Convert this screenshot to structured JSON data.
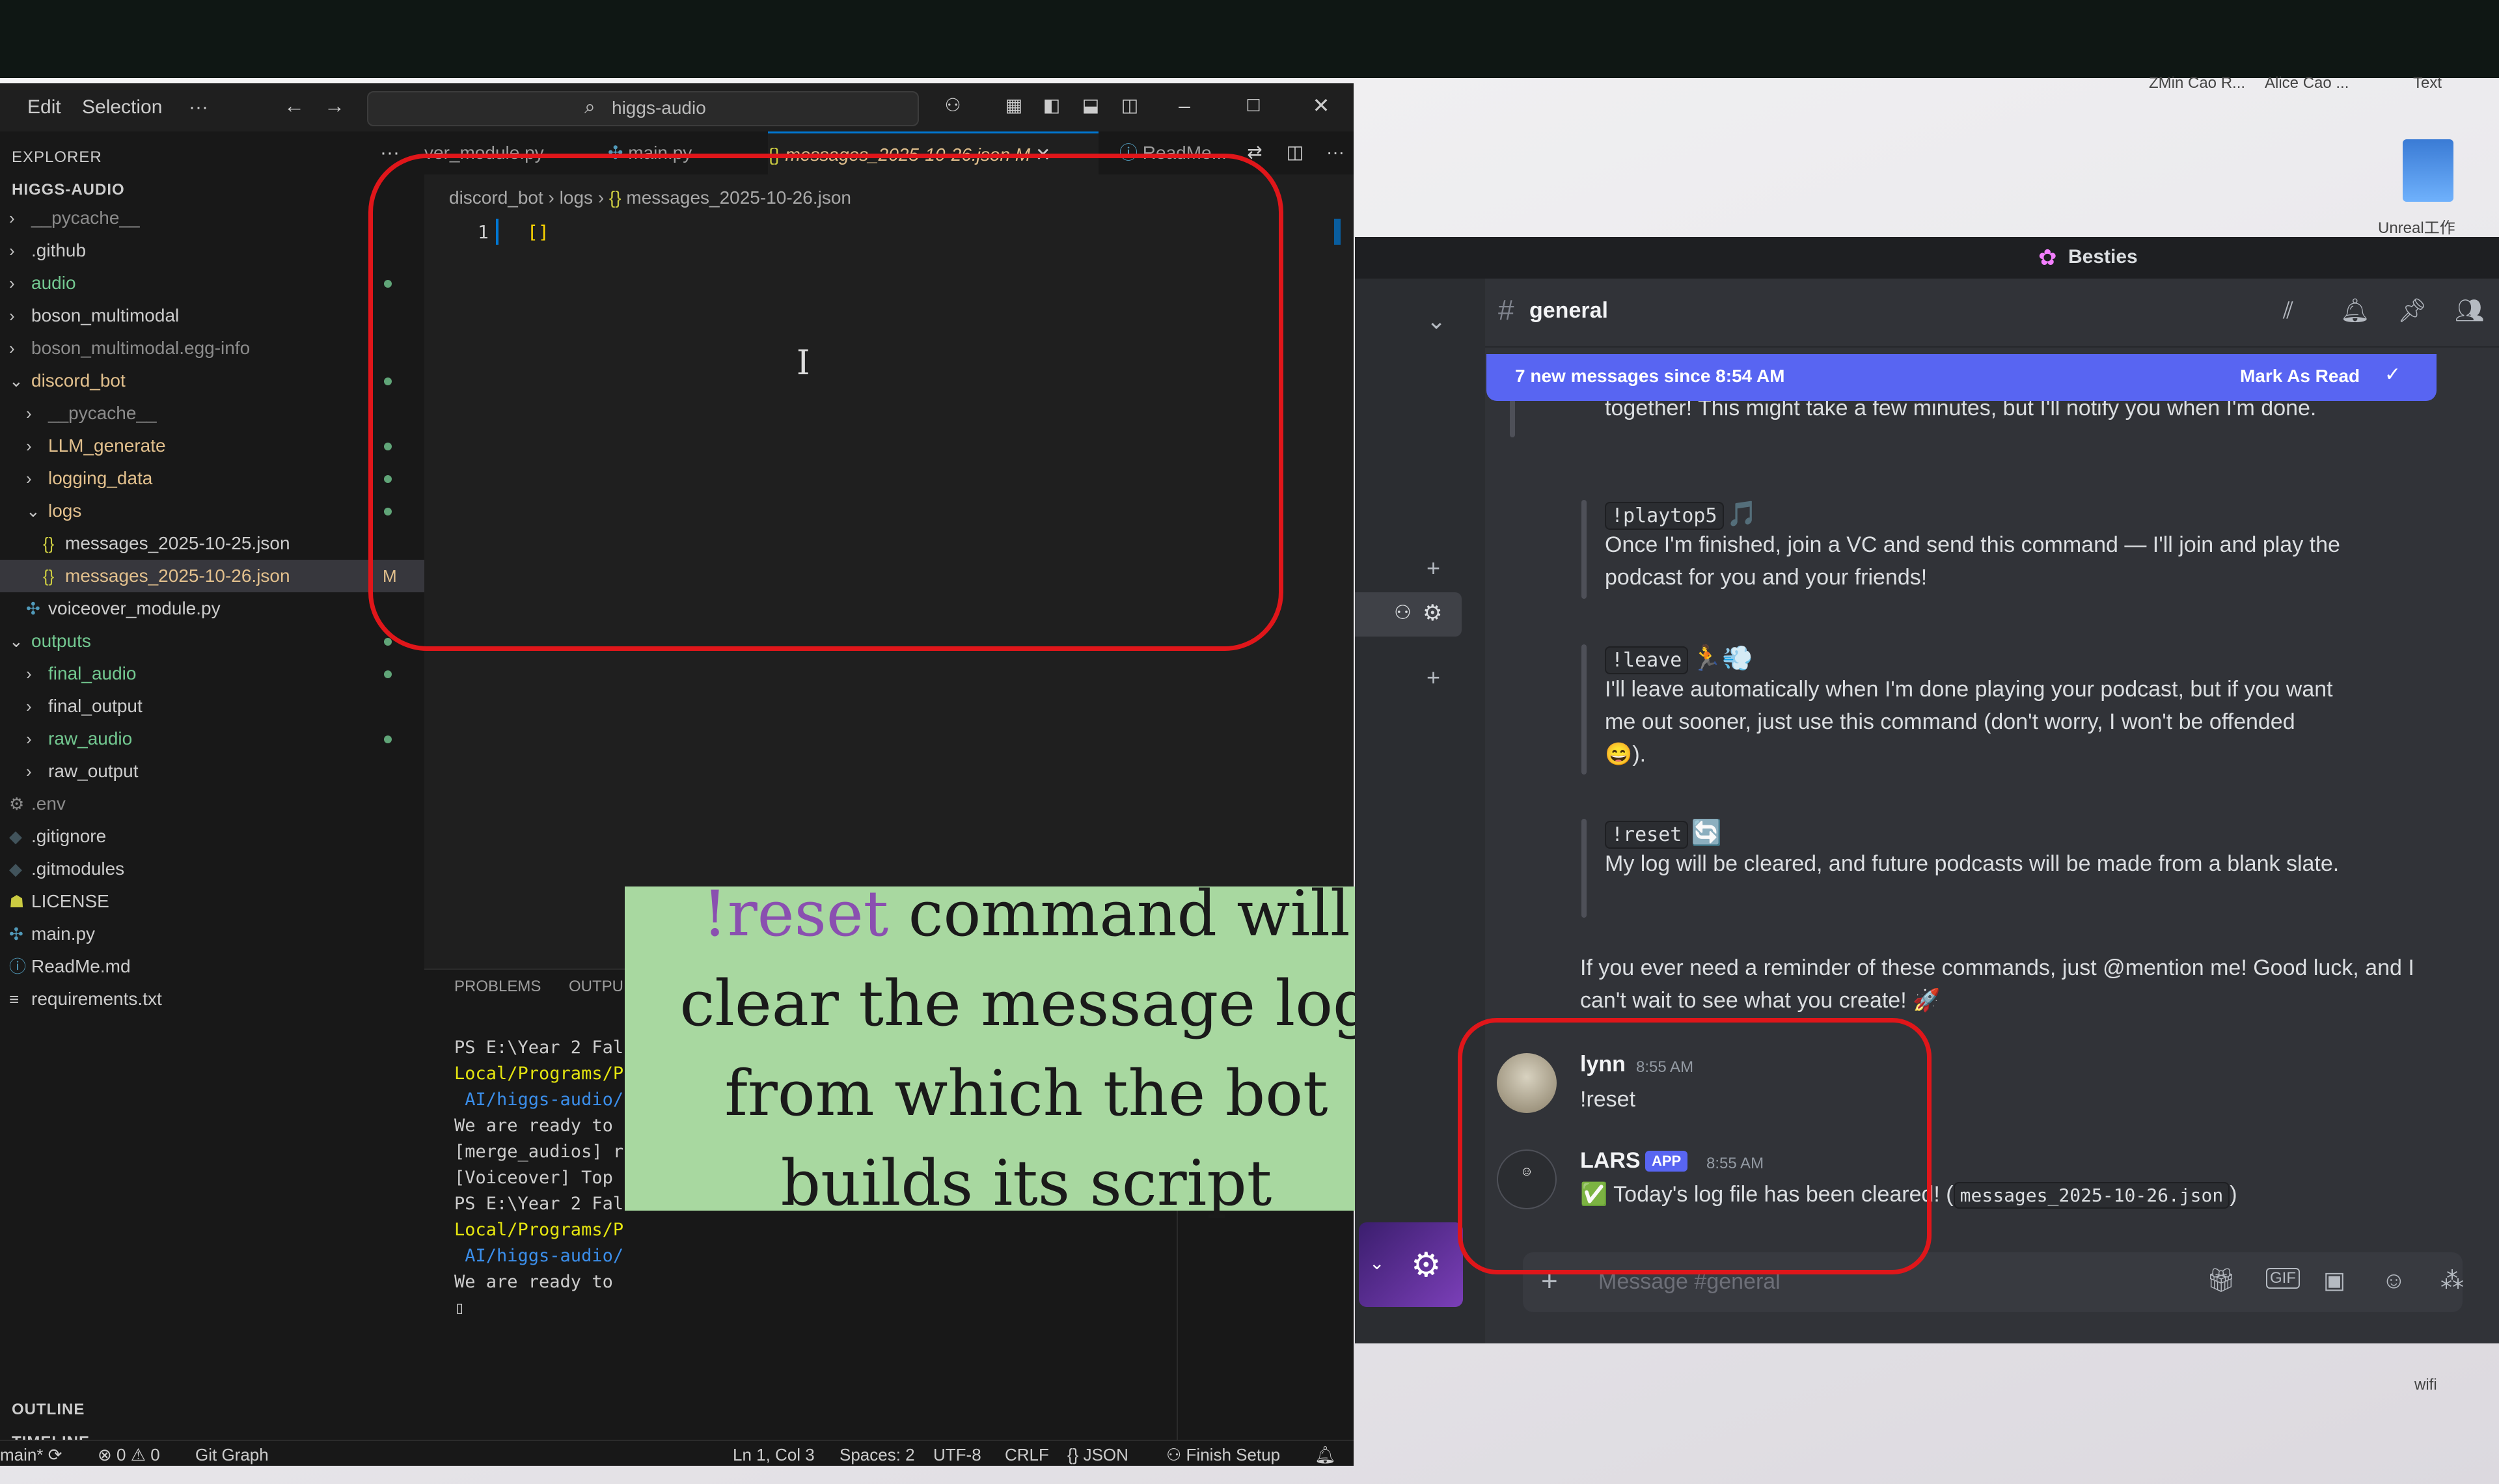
{
  "desktop": {
    "icon_labels": [
      "ZMin Cao R...",
      "Alice Cao ...",
      "Text"
    ],
    "app_label": "Unreal工作",
    "tray_label": "wifi"
  },
  "vscode": {
    "menu": [
      "Edit",
      "Selection",
      "···"
    ],
    "search": "higgs-audio",
    "explorer_title": "EXPLORER",
    "root": "HIGGS-AUDIO",
    "tree": [
      {
        "label": "__pycache__",
        "depth": 0,
        "kind": "folder",
        "style": "ignored"
      },
      {
        "label": ".github",
        "depth": 0,
        "kind": "folder",
        "style": "default"
      },
      {
        "label": "audio",
        "depth": 0,
        "kind": "folder",
        "style": "green",
        "dot": true
      },
      {
        "label": "boson_multimodal",
        "depth": 0,
        "kind": "folder",
        "style": "default"
      },
      {
        "label": "boson_multimodal.egg-info",
        "depth": 0,
        "kind": "folder",
        "style": "ignored"
      },
      {
        "label": "discord_bot",
        "depth": 0,
        "kind": "folder-open",
        "style": "modified",
        "dot": true
      },
      {
        "label": "__pycache__",
        "depth": 1,
        "kind": "folder",
        "style": "ignored"
      },
      {
        "label": "LLM_generate",
        "depth": 1,
        "kind": "folder",
        "style": "modified",
        "dot": true
      },
      {
        "label": "logging_data",
        "depth": 1,
        "kind": "folder",
        "style": "modified",
        "dot": true
      },
      {
        "label": "logs",
        "depth": 1,
        "kind": "folder-open",
        "style": "modified",
        "dot": true
      },
      {
        "label": "messages_2025-10-25.json",
        "depth": 2,
        "kind": "json",
        "style": "default"
      },
      {
        "label": "messages_2025-10-26.json",
        "depth": 2,
        "kind": "json",
        "style": "modified",
        "mark": "M",
        "selected": true
      },
      {
        "label": "voiceover_module.py",
        "depth": 1,
        "kind": "py",
        "style": "default"
      },
      {
        "label": "outputs",
        "depth": 0,
        "kind": "folder-open",
        "style": "green",
        "dot": true
      },
      {
        "label": "final_audio",
        "depth": 1,
        "kind": "folder",
        "style": "green",
        "dot": true
      },
      {
        "label": "final_output",
        "depth": 1,
        "kind": "folder",
        "style": "default"
      },
      {
        "label": "raw_audio",
        "depth": 1,
        "kind": "folder",
        "style": "green",
        "dot": true
      },
      {
        "label": "raw_output",
        "depth": 1,
        "kind": "folder",
        "style": "default"
      },
      {
        "label": ".env",
        "depth": 0,
        "kind": "gear",
        "style": "ignored"
      },
      {
        "label": ".gitignore",
        "depth": 0,
        "kind": "git",
        "style": "default"
      },
      {
        "label": ".gitmodules",
        "depth": 0,
        "kind": "git",
        "style": "default"
      },
      {
        "label": "LICENSE",
        "depth": 0,
        "kind": "license",
        "style": "default"
      },
      {
        "label": "main.py",
        "depth": 0,
        "kind": "py",
        "style": "default"
      },
      {
        "label": "ReadMe.md",
        "depth": 0,
        "kind": "info",
        "style": "default"
      },
      {
        "label": "requirements.txt",
        "depth": 0,
        "kind": "txt",
        "style": "default"
      }
    ],
    "outline": "OUTLINE",
    "timeline": "TIMELINE",
    "tabs": [
      {
        "label": "ver_module.py"
      },
      {
        "label": "main.py"
      },
      {
        "label": "messages_2025-10-26.json",
        "mark": "M",
        "active": true
      },
      {
        "label": "ReadMe..."
      }
    ],
    "breadcrumb": [
      "discord_bot",
      "logs",
      "messages_2025-10-26.json"
    ],
    "line_number": "1",
    "code": "[]",
    "panel_tabs": [
      "PROBLEMS",
      "OUTPU"
    ],
    "terminal": [
      {
        "text": "PS E:\\Year 2 Fal",
        "color": "#cccccc"
      },
      {
        "text": "Local/Programs/P",
        "color": "#e5e510"
      },
      {
        "text": " AI/higgs-audio/",
        "color": "#3b8eea"
      },
      {
        "text": "We are ready to",
        "color": "#cccccc"
      },
      {
        "text": "[merge_audios] r",
        "color": "#cccccc"
      },
      {
        "text": "[Voiceover] Top",
        "color": "#cccccc"
      },
      {
        "text": "PS E:\\Year 2 Fal",
        "color": "#cccccc"
      },
      {
        "text": "Local/Programs/P",
        "color": "#e5e510"
      },
      {
        "text": " AI/higgs-audio/",
        "color": "#3b8eea"
      },
      {
        "text": "We are ready to",
        "color": "#cccccc"
      },
      {
        "text": "▯",
        "color": "#cccccc"
      }
    ],
    "status": {
      "branch": "main*",
      "errors": "0",
      "warnings": "0",
      "git_graph": "Git Graph",
      "position": "Ln 1, Col 3",
      "spaces": "Spaces: 2",
      "encoding": "UTF-8",
      "eol": "CRLF",
      "language": "JSON",
      "finish_setup": "Finish Setup"
    }
  },
  "caption": {
    "highlight": "!reset",
    "rest": " command will clear the message log from which the bot builds its script",
    "bg": "#a8d8a0"
  },
  "discord": {
    "server": "Besties",
    "channel": "general",
    "new_bar": "7 new messages since 8:54 AM",
    "mark_read": "Mark As Read",
    "accent": "#5865f2",
    "top_fragment": "together! This might take a few minutes, but I'll notify you when I'm done.",
    "blocks": [
      {
        "cmd": "!playtop5",
        "emoji": "🎵",
        "text": "Once I'm finished, join a VC and send this command — I'll join and play the podcast for you and your friends!"
      },
      {
        "cmd": "!leave",
        "emoji": "🏃💨",
        "text": "I'll leave automatically when I'm done playing your podcast, but if you want me out sooner, just use this command (don't worry, I won't be offended 😄)."
      },
      {
        "cmd": "!reset",
        "emoji": "🔄",
        "text": "My log will be cleared, and future podcasts will be made from a blank slate."
      }
    ],
    "footer_msg": "If you ever need a reminder of these commands, just @mention me! Good luck, and I can't wait to see what you create! 🚀",
    "messages": [
      {
        "user": "lynn",
        "time": "8:55 AM",
        "text": "!reset"
      },
      {
        "user": "LARS",
        "badge": "APP",
        "time": "8:55 AM",
        "text": "✅ Today's log file has been cleared! (",
        "code": "messages_2025-10-26.json",
        "after": ")"
      }
    ],
    "composer_placeholder": "Message #general"
  }
}
